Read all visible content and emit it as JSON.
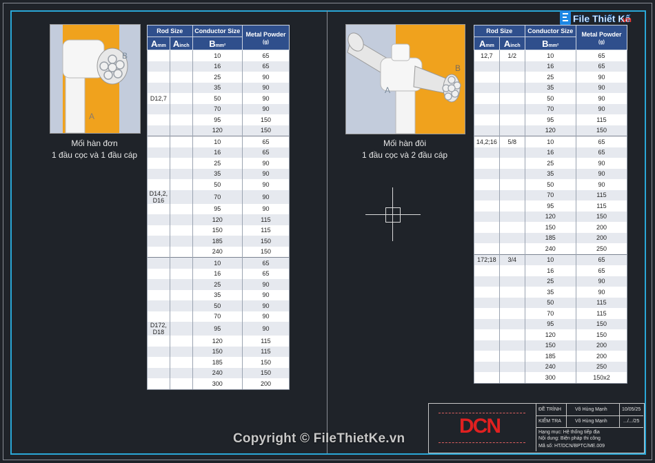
{
  "logo": {
    "text": "File Thiết Kế",
    "suffix": ".vn"
  },
  "left": {
    "caption_line1": "Mối hàn đơn",
    "caption_line2": "1 đầu cọc và 1 đầu cáp",
    "label_a": "A",
    "label_b": "B",
    "table": {
      "h_rod": "Rod Size",
      "h_cond": "Conductor Size",
      "h_powder": "Metal Powder",
      "h_powder_unit": "(g)",
      "h_a": "A",
      "h_a_sub": "mm",
      "h_ainch": "A",
      "h_ainch_sub": "inch",
      "h_b": "B",
      "h_b_sub": "mm²",
      "rows": [
        {
          "a": "",
          "i": "",
          "b": "10",
          "p": "65"
        },
        {
          "a": "",
          "i": "",
          "b": "16",
          "p": "65"
        },
        {
          "a": "",
          "i": "",
          "b": "25",
          "p": "90"
        },
        {
          "a": "",
          "i": "",
          "b": "35",
          "p": "90"
        },
        {
          "a": "D12,7",
          "i": "",
          "b": "50",
          "p": "90"
        },
        {
          "a": "",
          "i": "",
          "b": "70",
          "p": "90"
        },
        {
          "a": "",
          "i": "",
          "b": "95",
          "p": "150"
        },
        {
          "a": "",
          "i": "",
          "b": "120",
          "p": "150"
        },
        {
          "a": "",
          "i": "",
          "b": "10",
          "p": "65"
        },
        {
          "a": "",
          "i": "",
          "b": "16",
          "p": "65"
        },
        {
          "a": "",
          "i": "",
          "b": "25",
          "p": "90"
        },
        {
          "a": "",
          "i": "",
          "b": "35",
          "p": "90"
        },
        {
          "a": "",
          "i": "",
          "b": "50",
          "p": "90"
        },
        {
          "a": "D14,2, D16",
          "i": "",
          "b": "70",
          "p": "90"
        },
        {
          "a": "",
          "i": "",
          "b": "95",
          "p": "90"
        },
        {
          "a": "",
          "i": "",
          "b": "120",
          "p": "115"
        },
        {
          "a": "",
          "i": "",
          "b": "150",
          "p": "115"
        },
        {
          "a": "",
          "i": "",
          "b": "185",
          "p": "150"
        },
        {
          "a": "",
          "i": "",
          "b": "240",
          "p": "150"
        },
        {
          "a": "",
          "i": "",
          "b": "10",
          "p": "65"
        },
        {
          "a": "",
          "i": "",
          "b": "16",
          "p": "65"
        },
        {
          "a": "",
          "i": "",
          "b": "25",
          "p": "90"
        },
        {
          "a": "",
          "i": "",
          "b": "35",
          "p": "90"
        },
        {
          "a": "",
          "i": "",
          "b": "50",
          "p": "90"
        },
        {
          "a": "",
          "i": "",
          "b": "70",
          "p": "90"
        },
        {
          "a": "D172, D18",
          "i": "",
          "b": "95",
          "p": "90"
        },
        {
          "a": "",
          "i": "",
          "b": "120",
          "p": "115"
        },
        {
          "a": "",
          "i": "",
          "b": "150",
          "p": "115"
        },
        {
          "a": "",
          "i": "",
          "b": "185",
          "p": "150"
        },
        {
          "a": "",
          "i": "",
          "b": "240",
          "p": "150"
        },
        {
          "a": "",
          "i": "",
          "b": "300",
          "p": "200"
        }
      ]
    }
  },
  "right": {
    "caption_line1": "Mối hàn đôi",
    "caption_line2": "1 đầu cọc và 2 đầu cáp",
    "label_a": "A",
    "label_b": "B",
    "table": {
      "rows": [
        {
          "a": "12,7",
          "i": "1/2",
          "b": "10",
          "p": "65"
        },
        {
          "a": "",
          "i": "",
          "b": "16",
          "p": "65"
        },
        {
          "a": "",
          "i": "",
          "b": "25",
          "p": "90"
        },
        {
          "a": "",
          "i": "",
          "b": "35",
          "p": "90"
        },
        {
          "a": "",
          "i": "",
          "b": "50",
          "p": "90"
        },
        {
          "a": "",
          "i": "",
          "b": "70",
          "p": "90"
        },
        {
          "a": "",
          "i": "",
          "b": "95",
          "p": "115"
        },
        {
          "a": "",
          "i": "",
          "b": "120",
          "p": "150"
        },
        {
          "a": "14,2;16",
          "i": "5/8",
          "b": "10",
          "p": "65"
        },
        {
          "a": "",
          "i": "",
          "b": "16",
          "p": "65"
        },
        {
          "a": "",
          "i": "",
          "b": "25",
          "p": "90"
        },
        {
          "a": "",
          "i": "",
          "b": "35",
          "p": "90"
        },
        {
          "a": "",
          "i": "",
          "b": "50",
          "p": "90"
        },
        {
          "a": "",
          "i": "",
          "b": "70",
          "p": "115"
        },
        {
          "a": "",
          "i": "",
          "b": "95",
          "p": "115"
        },
        {
          "a": "",
          "i": "",
          "b": "120",
          "p": "150"
        },
        {
          "a": "",
          "i": "",
          "b": "150",
          "p": "200"
        },
        {
          "a": "",
          "i": "",
          "b": "185",
          "p": "200"
        },
        {
          "a": "",
          "i": "",
          "b": "240",
          "p": "250"
        },
        {
          "a": "172;18",
          "i": "3/4",
          "b": "10",
          "p": "65"
        },
        {
          "a": "",
          "i": "",
          "b": "16",
          "p": "65"
        },
        {
          "a": "",
          "i": "",
          "b": "25",
          "p": "90"
        },
        {
          "a": "",
          "i": "",
          "b": "35",
          "p": "90"
        },
        {
          "a": "",
          "i": "",
          "b": "50",
          "p": "115"
        },
        {
          "a": "",
          "i": "",
          "b": "70",
          "p": "115"
        },
        {
          "a": "",
          "i": "",
          "b": "95",
          "p": "150"
        },
        {
          "a": "",
          "i": "",
          "b": "120",
          "p": "150"
        },
        {
          "a": "",
          "i": "",
          "b": "150",
          "p": "200"
        },
        {
          "a": "",
          "i": "",
          "b": "185",
          "p": "200"
        },
        {
          "a": "",
          "i": "",
          "b": "240",
          "p": "250"
        },
        {
          "a": "",
          "i": "",
          "b": "300",
          "p": "150x2"
        }
      ]
    }
  },
  "title_block": {
    "logo": "DCN",
    "label_submit": "ĐỀ TRÌNH",
    "label_check": "KIỂM TRA",
    "submit_name": "Võ Hùng Mạnh",
    "check_name": "Võ Hùng Mạnh",
    "submit_date": "10/05/25",
    "check_date": ".../.../25",
    "line1": "Hạng mục: Hệ thống tiếp địa",
    "line2": "Nội dung: Biện pháp thi công",
    "line3": "Mã số: HT/DCN/BPTC/ME.009"
  },
  "copyright": "Copyright © FileThietKe.vn",
  "colors": {
    "header": "#2f4f8c",
    "frame": "#2aa8d8",
    "orange": "#f0a21d",
    "logo_red": "#e02020"
  }
}
